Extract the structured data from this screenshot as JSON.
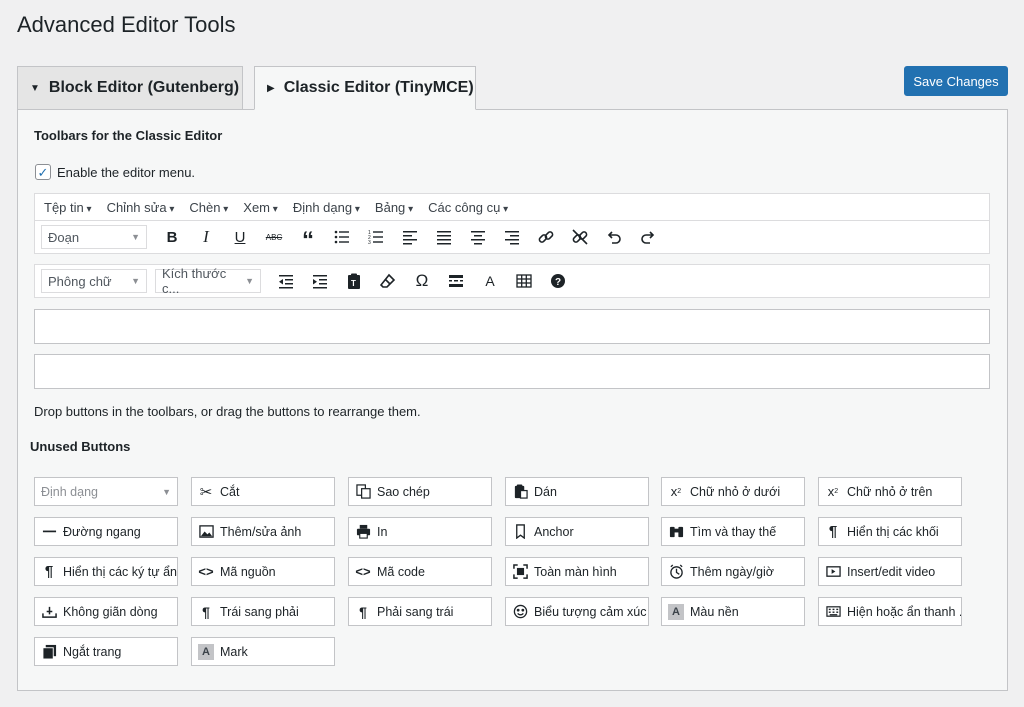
{
  "page": {
    "title": "Advanced Editor Tools"
  },
  "tabs": [
    {
      "label": "Block Editor (Gutenberg)",
      "active": false
    },
    {
      "label": "Classic Editor (TinyMCE)",
      "active": true
    }
  ],
  "save_label": "Save Changes",
  "section": {
    "title": "Toolbars for the Classic Editor",
    "enable_menu_label": "Enable the editor menu.",
    "enable_menu_checked": true
  },
  "menubar": [
    "Tệp tin",
    "Chỉnh sửa",
    "Chèn",
    "Xem",
    "Định dạng",
    "Bảng",
    "Các công cụ"
  ],
  "toolbar1": {
    "select": "Đoạn",
    "buttons": [
      "bold-icon",
      "italic-icon",
      "underline-icon",
      "strikethrough-icon",
      "blockquote-icon",
      "bullet-list-icon",
      "numbered-list-icon",
      "align-left-icon",
      "align-justify-icon",
      "align-center-icon",
      "align-right-icon",
      "link-icon",
      "unlink-icon",
      "undo-icon",
      "redo-icon"
    ]
  },
  "toolbar2": {
    "select1": "Phông chữ",
    "select2": "Kích thước c...",
    "buttons": [
      "outdent-icon",
      "indent-icon",
      "paste-text-icon",
      "clear-format-icon",
      "omega-icon",
      "read-more-icon",
      "text-color-icon",
      "table-icon",
      "help-icon"
    ]
  },
  "help_text": "Drop buttons in the toolbars, or drag the buttons to rearrange them.",
  "unused": {
    "title": "Unused Buttons",
    "select_label": "Định dạng",
    "buttons": [
      {
        "label": "Cắt",
        "icon": "scissors-icon"
      },
      {
        "label": "Sao chép",
        "icon": "copy-icon"
      },
      {
        "label": "Dán",
        "icon": "paste-icon"
      },
      {
        "label": "Chữ nhỏ ở dưới",
        "icon": "subscript-icon"
      },
      {
        "label": "Chữ nhỏ ở trên",
        "icon": "superscript-icon"
      },
      {
        "label": "Đường ngang",
        "icon": "horizontal-line-icon"
      },
      {
        "label": "Thêm/sửa ảnh",
        "icon": "image-icon"
      },
      {
        "label": "In",
        "icon": "print-icon"
      },
      {
        "label": "Anchor",
        "icon": "bookmark-icon"
      },
      {
        "label": "Tìm và thay thế",
        "icon": "binoculars-icon"
      },
      {
        "label": "Hiển thị các khối",
        "icon": "pilcrow-icon"
      },
      {
        "label": "Hiển thị các ký tự ẩn",
        "icon": "pilcrow-icon"
      },
      {
        "label": "Mã nguồn",
        "icon": "code-icon"
      },
      {
        "label": "Mã code",
        "icon": "code-icon"
      },
      {
        "label": "Toàn màn hình",
        "icon": "fullscreen-icon"
      },
      {
        "label": "Thêm ngày/giờ",
        "icon": "clock-icon"
      },
      {
        "label": "Insert/edit video",
        "icon": "video-icon"
      },
      {
        "label": "Không giãn dòng",
        "icon": "nonbreaking-icon"
      },
      {
        "label": "Trái sang phải",
        "icon": "ltr-icon"
      },
      {
        "label": "Phải sang trái",
        "icon": "rtl-icon"
      },
      {
        "label": "Biểu tượng cảm xúc",
        "icon": "emoticon-icon"
      },
      {
        "label": "Màu nền",
        "icon": "background-color-icon"
      },
      {
        "label": "Hiện hoặc ẩn thanh ...",
        "icon": "keyboard-icon"
      },
      {
        "label": "Ngắt trang",
        "icon": "page-break-icon"
      },
      {
        "label": "Mark",
        "icon": "mark-icon"
      }
    ]
  }
}
